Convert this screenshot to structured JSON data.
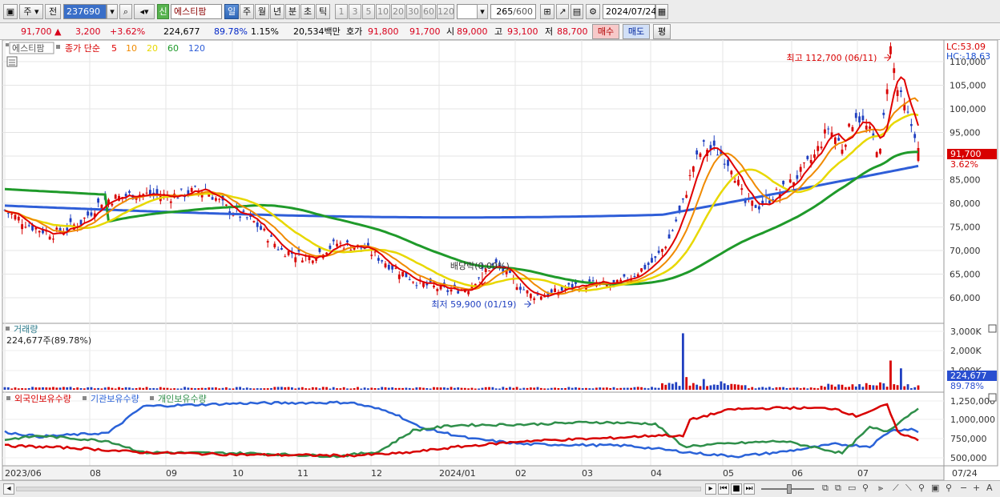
{
  "toolbar": {
    "chart_type": "주",
    "prev": "전",
    "code": "237690",
    "name_badge": "신",
    "stock_name": "에스티팜",
    "periods": [
      "일",
      "주",
      "월",
      "년",
      "분",
      "초",
      "틱"
    ],
    "active_period": "일",
    "intervals": [
      "1",
      "3",
      "5",
      "10",
      "20",
      "30",
      "60",
      "120"
    ],
    "count": "265",
    "count_total": "/600",
    "date": "2024/07/24"
  },
  "quote": {
    "price": "91,700",
    "change": "3,200",
    "change_pct": "+3.62%",
    "volume": "224,677",
    "vol_ratio": "89.78%",
    "turnover": "1.15%",
    "amount": "20,534백만",
    "ask_label": "호가",
    "ask": "91,800",
    "bid": "91,700",
    "open_label": "시",
    "open": "89,000",
    "high_label": "고",
    "high": "93,100",
    "low_label": "저",
    "low": "88,700",
    "buy_btn": "매수",
    "sell_btn": "매도",
    "eval_btn": "평"
  },
  "price_pane": {
    "name_tag": "에스티팜",
    "legend_prefix": "종가 단순",
    "ma": [
      {
        "label": "5",
        "color": "#e00000"
      },
      {
        "label": "10",
        "color": "#f08a00"
      },
      {
        "label": "20",
        "color": "#e8d800"
      },
      {
        "label": "60",
        "color": "#1f9a2a"
      },
      {
        "label": "120",
        "color": "#2f5ed8"
      }
    ],
    "lc": "LC:53.09",
    "hc": "HC:-18.63",
    "max_label": "최고 112,700 (06/11)",
    "min_label": "최저 59,900 (01/19)",
    "dividend_label": "배당락(0.00%)",
    "last_price": "91,700",
    "last_pct": "3.62%",
    "y_ticks": [
      "110,000",
      "105,000",
      "100,000",
      "95,000",
      "90,000",
      "85,000",
      "80,000",
      "75,000",
      "70,000",
      "65,000",
      "60,000"
    ]
  },
  "volume_pane": {
    "title": "거래량",
    "value": "224,677주(89.78%)",
    "y_ticks": [
      "3,000K",
      "2,000K",
      "1,000K"
    ],
    "last": "224,677",
    "last_pct": "89.78%"
  },
  "holding_pane": {
    "series": [
      {
        "label": "외국인보유수량",
        "color": "#d80000"
      },
      {
        "label": "기관보유수량",
        "color": "#2a62d8"
      },
      {
        "label": "개인보유수량",
        "color": "#2f8f4a"
      }
    ],
    "y_ticks": [
      "1,250,000",
      "1,000,000",
      "750,000",
      "500,000"
    ]
  },
  "x_axis": {
    "labels": [
      "2023/06",
      "08",
      "09",
      "10",
      "11",
      "12",
      "2024/01",
      "02",
      "03",
      "04",
      "05",
      "06",
      "07"
    ],
    "last_date": "07/24"
  }
}
